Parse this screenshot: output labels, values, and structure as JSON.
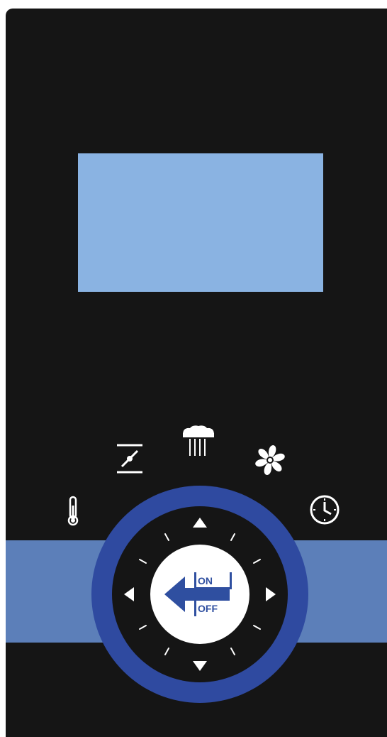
{
  "panel": {
    "mode_icons": [
      {
        "name": "temperature-icon"
      },
      {
        "name": "damper-icon"
      },
      {
        "name": "steam-icon"
      },
      {
        "name": "fan-icon"
      },
      {
        "name": "timer-icon"
      }
    ]
  },
  "dial": {
    "center_button": {
      "on_label": "ON",
      "off_label": "OFF"
    }
  },
  "colors": {
    "panel": "#151515",
    "display": "#8ab3e2",
    "band": "#5c7fb9",
    "ring": "#2f4aa0",
    "button_text": "#2f4fa0"
  }
}
